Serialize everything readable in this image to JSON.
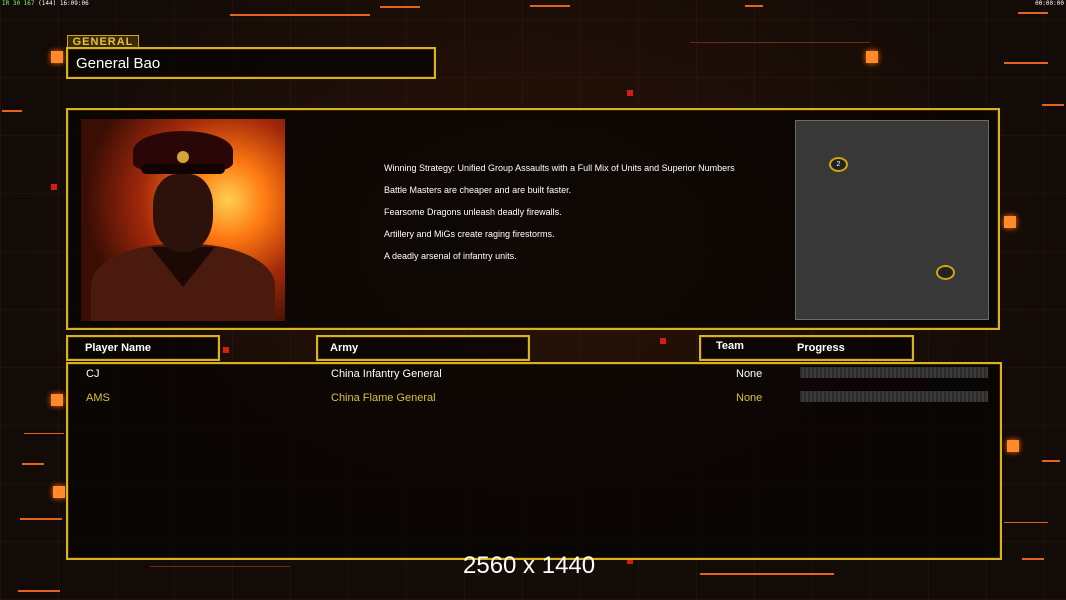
{
  "hud": {
    "stats_green": "IR 30 167",
    "stats_grey": "(144)",
    "clock_left": "16:09:06",
    "clock_right": "00:00:00"
  },
  "general_panel": {
    "tag_label": "GENERAL",
    "general_name": "General Bao"
  },
  "description": {
    "lines": [
      "Winning Strategy: Unified Group Assaults with a Full Mix of Units and Superior Numbers",
      "Battle Masters are cheaper and are built faster.",
      "Fearsome Dragons unleash deadly firewalls.",
      "Artillery and MiGs create raging firestorms.",
      "A deadly arsenal of infantry units."
    ]
  },
  "minimap": {
    "markers": [
      {
        "label": "2"
      },
      {
        "label": ""
      }
    ]
  },
  "table": {
    "headers": {
      "player_name": "Player Name",
      "army": "Army",
      "team": "Team",
      "progress": "Progress"
    },
    "rows": [
      {
        "name": "CJ",
        "army": "China Infantry General",
        "team": "None",
        "progress": 0,
        "color": "#ffffff"
      },
      {
        "name": "AMS",
        "army": "China Flame General",
        "team": "None",
        "progress": 0,
        "color": "#d9c23a"
      }
    ]
  },
  "overlay": {
    "resolution_text": "2560 x 1440"
  },
  "colors": {
    "frame_gold": "#d7b419",
    "accent_orange": "#ff8a2a"
  }
}
